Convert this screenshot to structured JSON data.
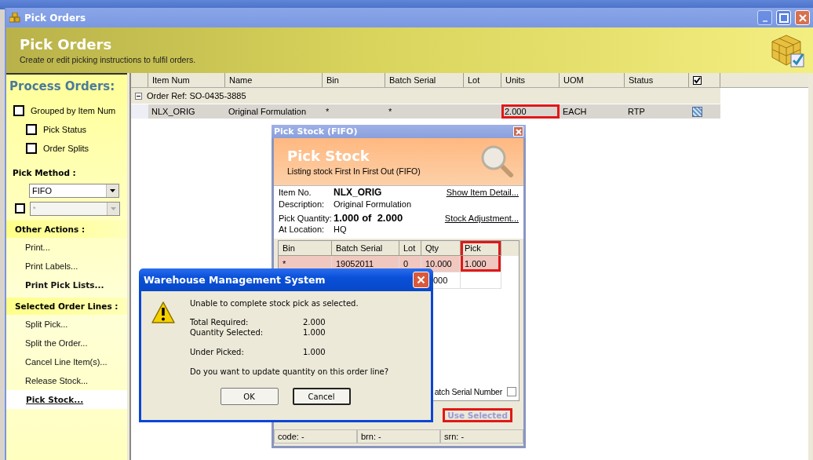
{
  "window": {
    "title": "Pick Orders"
  },
  "header": {
    "title": "Pick Orders",
    "subtitle": "Create or edit picking instructions to fulfil orders."
  },
  "sidebar": {
    "title": "Process Orders:",
    "options": [
      {
        "label": "Grouped by Item Num",
        "checked": false,
        "children": [
          {
            "label": "Pick Status",
            "checked": false
          },
          {
            "label": "Order Splits",
            "checked": false
          }
        ]
      }
    ],
    "pick_method": {
      "label": "Pick Method :",
      "value": "FIFO",
      "filter": {
        "checked": false,
        "value": "*",
        "disabled": true
      }
    },
    "sections": [
      {
        "title": "Other Actions :",
        "items": [
          {
            "label": "Print...",
            "emphasized": false,
            "selected": false
          },
          {
            "label": "Print Labels...",
            "emphasized": false,
            "selected": false
          },
          {
            "label": "Print Pick Lists...",
            "emphasized": true,
            "selected": false
          }
        ]
      },
      {
        "title": "Selected Order Lines :",
        "items": [
          {
            "label": "Split Pick...",
            "emphasized": false,
            "selected": false
          },
          {
            "label": "Split the Order...",
            "emphasized": false,
            "selected": false
          },
          {
            "label": "Cancel Line Item(s)...",
            "emphasized": false,
            "selected": false
          },
          {
            "label": "Release Stock...",
            "emphasized": false,
            "selected": false
          },
          {
            "label": "Pick Stock...",
            "emphasized": true,
            "selected": true
          }
        ]
      }
    ]
  },
  "table": {
    "columns": [
      "Item Num",
      "Name",
      "Bin",
      "Batch Serial",
      "Lot",
      "Units",
      "UOM",
      "Status"
    ],
    "header_checked": true,
    "groups": [
      {
        "label": "Order Ref: SO-0435-3885",
        "expanded": true,
        "rows": [
          {
            "cells": [
              {
                "text": "NLX_ORIG",
                "annotated": false
              },
              {
                "text": "Original Formulation",
                "annotated": false
              },
              {
                "text": "*",
                "annotated": false
              },
              {
                "text": "*",
                "annotated": false
              },
              {
                "text": null,
                "annotated": false
              },
              {
                "text": "2.000",
                "annotated": true
              },
              {
                "text": "EACH",
                "annotated": false
              },
              {
                "text": "RTP",
                "annotated": false
              }
            ],
            "checked": true
          }
        ]
      }
    ]
  },
  "pick_stock": {
    "title": "Pick Stock (FIFO)",
    "header": {
      "title": "Pick Stock",
      "subtitle": "Listing stock First In First Out (FIFO)"
    },
    "item_no": {
      "label": "Item No.",
      "value": "NLX_ORIG"
    },
    "description": {
      "label": "Description:",
      "value": "Original Formulation"
    },
    "pick_quantity": {
      "label": "Pick Quantity:",
      "value": "1.000 of  2.000"
    },
    "location": {
      "label": "At Location:",
      "value": "HQ"
    },
    "links": [
      "Show Item Detail...",
      "Stock Adjustment..."
    ],
    "columns": [
      {
        "label": "Bin",
        "annotated": false
      },
      {
        "label": "Batch Serial",
        "annotated": false
      },
      {
        "label": "Lot",
        "annotated": false
      },
      {
        "label": "Qty",
        "annotated": false
      },
      {
        "label": "Pick",
        "annotated": true
      }
    ],
    "rows": [
      {
        "cells": [
          "*",
          "19052011",
          "0",
          "10.000",
          "1.000"
        ],
        "selected": true
      },
      {
        "cells": [
          null,
          null,
          null,
          "000",
          null
        ],
        "selected": false
      }
    ],
    "batch_option": {
      "label": "atch Serial Number",
      "checked": false
    },
    "use_selected": {
      "label": "Use Selected",
      "disabled": true,
      "annotated": true
    },
    "status": [
      "code: -",
      "brn: -",
      "srn: -"
    ]
  },
  "message_box": {
    "title": "Warehouse Management System",
    "message": "Unable to complete stock pick as selected.",
    "groups": [
      [
        {
          "label": "Total Required:",
          "value": "2.000"
        },
        {
          "label": "Quantity Selected:",
          "value": "1.000"
        }
      ],
      [
        {
          "label": "Under Picked:",
          "value": "1.000"
        }
      ]
    ],
    "question": "Do you want to update quantity on this order line?",
    "buttons": [
      {
        "label": "OK",
        "focused": false
      },
      {
        "label": "Cancel",
        "focused": true
      }
    ]
  }
}
